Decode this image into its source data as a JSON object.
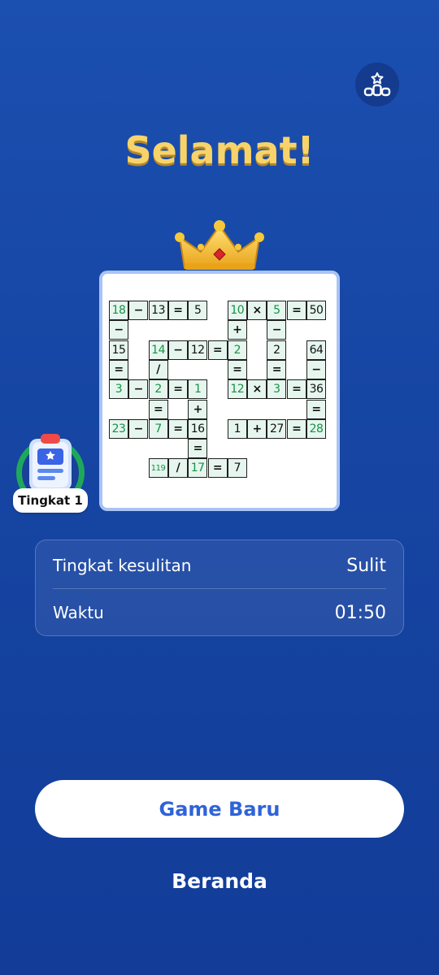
{
  "header": {
    "stats_icon": "podium-star-icon"
  },
  "title": "Selamat!",
  "crown_icon": "crown-icon",
  "puzzle": {
    "colors": {
      "given": "#111111",
      "filled": "#149245",
      "cell_bg": "#e6f6ef"
    },
    "cells": [
      {
        "r": 0,
        "c": 0,
        "v": "18",
        "g": 1
      },
      {
        "r": 0,
        "c": 1,
        "v": "−"
      },
      {
        "r": 0,
        "c": 2,
        "v": "13"
      },
      {
        "r": 0,
        "c": 3,
        "v": "="
      },
      {
        "r": 0,
        "c": 4,
        "v": "5"
      },
      {
        "r": 0,
        "c": 6,
        "v": "10",
        "g": 1
      },
      {
        "r": 0,
        "c": 7,
        "v": "×"
      },
      {
        "r": 0,
        "c": 8,
        "v": "5",
        "g": 1
      },
      {
        "r": 0,
        "c": 9,
        "v": "="
      },
      {
        "r": 0,
        "c": 10,
        "v": "50"
      },
      {
        "r": 1,
        "c": 0,
        "v": "−"
      },
      {
        "r": 1,
        "c": 6,
        "v": "+"
      },
      {
        "r": 1,
        "c": 8,
        "v": "−"
      },
      {
        "r": 2,
        "c": 0,
        "v": "15"
      },
      {
        "r": 2,
        "c": 2,
        "v": "14",
        "g": 1
      },
      {
        "r": 2,
        "c": 3,
        "v": "−"
      },
      {
        "r": 2,
        "c": 4,
        "v": "12"
      },
      {
        "r": 2,
        "c": 5,
        "v": "="
      },
      {
        "r": 2,
        "c": 6,
        "v": "2",
        "g": 1
      },
      {
        "r": 2,
        "c": 8,
        "v": "2"
      },
      {
        "r": 2,
        "c": 10,
        "v": "64"
      },
      {
        "r": 3,
        "c": 0,
        "v": "="
      },
      {
        "r": 3,
        "c": 2,
        "v": "/"
      },
      {
        "r": 3,
        "c": 6,
        "v": "="
      },
      {
        "r": 3,
        "c": 8,
        "v": "="
      },
      {
        "r": 3,
        "c": 10,
        "v": "−"
      },
      {
        "r": 4,
        "c": 0,
        "v": "3",
        "g": 1
      },
      {
        "r": 4,
        "c": 1,
        "v": "−"
      },
      {
        "r": 4,
        "c": 2,
        "v": "2",
        "g": 1
      },
      {
        "r": 4,
        "c": 3,
        "v": "="
      },
      {
        "r": 4,
        "c": 4,
        "v": "1",
        "g": 1
      },
      {
        "r": 4,
        "c": 6,
        "v": "12",
        "g": 1
      },
      {
        "r": 4,
        "c": 7,
        "v": "×"
      },
      {
        "r": 4,
        "c": 8,
        "v": "3",
        "g": 1
      },
      {
        "r": 4,
        "c": 9,
        "v": "="
      },
      {
        "r": 4,
        "c": 10,
        "v": "36"
      },
      {
        "r": 5,
        "c": 2,
        "v": "="
      },
      {
        "r": 5,
        "c": 4,
        "v": "+"
      },
      {
        "r": 5,
        "c": 10,
        "v": "="
      },
      {
        "r": 6,
        "c": 0,
        "v": "23",
        "g": 1
      },
      {
        "r": 6,
        "c": 1,
        "v": "−"
      },
      {
        "r": 6,
        "c": 2,
        "v": "7",
        "g": 1
      },
      {
        "r": 6,
        "c": 3,
        "v": "="
      },
      {
        "r": 6,
        "c": 4,
        "v": "16"
      },
      {
        "r": 6,
        "c": 6,
        "v": "1"
      },
      {
        "r": 6,
        "c": 7,
        "v": "+"
      },
      {
        "r": 6,
        "c": 8,
        "v": "27"
      },
      {
        "r": 6,
        "c": 9,
        "v": "="
      },
      {
        "r": 6,
        "c": 10,
        "v": "28",
        "g": 1
      },
      {
        "r": 7,
        "c": 4,
        "v": "="
      },
      {
        "r": 8,
        "c": 2,
        "v": "119",
        "g": 1,
        "s": 1
      },
      {
        "r": 8,
        "c": 3,
        "v": "/"
      },
      {
        "r": 8,
        "c": 4,
        "v": "17",
        "g": 1
      },
      {
        "r": 8,
        "c": 5,
        "v": "="
      },
      {
        "r": 8,
        "c": 6,
        "v": "7"
      }
    ]
  },
  "level": {
    "label": "Tingkat 1",
    "icon": "clipboard-star-icon"
  },
  "info": {
    "difficulty_label": "Tingkat kesulitan",
    "difficulty_value": "Sulit",
    "time_label": "Waktu",
    "time_value": "01:50"
  },
  "actions": {
    "new_game": "Game Baru",
    "home": "Beranda"
  }
}
